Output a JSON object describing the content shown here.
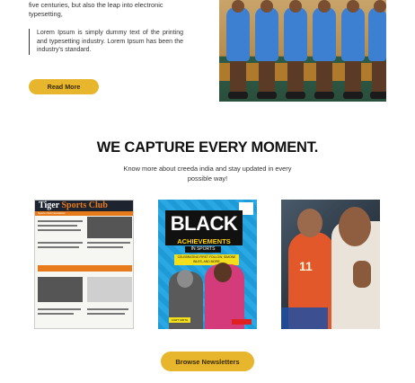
{
  "about": {
    "intro_text": "five centuries, but also the leap into electronic typesetting,",
    "quote_text": "Lorem Ipsum is simply dummy text of the printing and typesetting industry. Lorem Ipsum has been the industry's standard.",
    "read_more_label": "Read More"
  },
  "newsletters": {
    "heading": "WE CAPTURE EVERY MOMENT.",
    "subheading": "Know more about creeda india and stay updated in every possible way!",
    "browse_label": "Browse Newsletters",
    "cards": [
      {
        "masthead_prefix": "Tiger ",
        "masthead_accent": "Sports Club",
        "subtitle": "Sports Club Newsletter"
      },
      {
        "title": "BLACK",
        "subtitle": "ACHIEVEMENTS",
        "tagline": "IN SPORTS",
        "blurb": "CELEBRATING FIRST FOLLOW, SIMONE BILES, AND MORE",
        "author": "CURT SMITH"
      },
      {
        "jersey_number": "11"
      }
    ]
  },
  "colors": {
    "accent": "#e7b62c",
    "newsletter_orange": "#e77b1c",
    "book_blue": "#1e9bd7"
  }
}
